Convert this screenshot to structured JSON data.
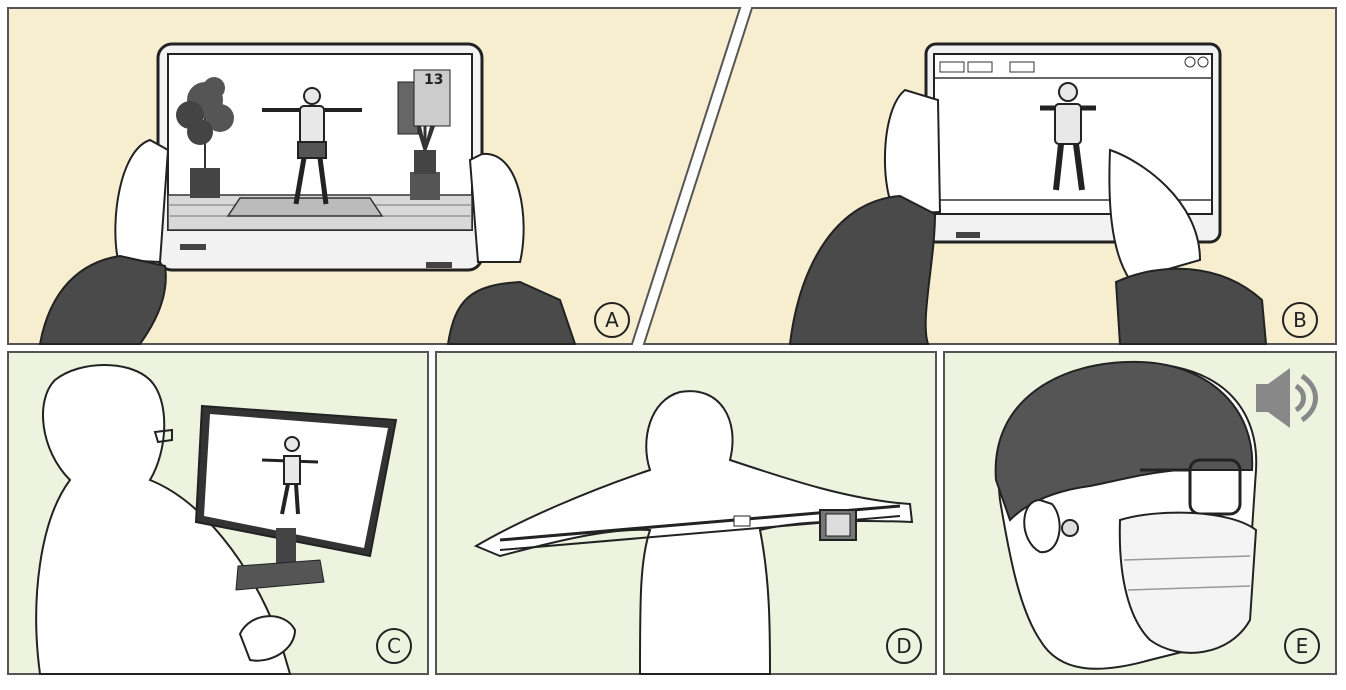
{
  "panels": [
    {
      "id": "A",
      "label": "A",
      "bg": "#f6eecf"
    },
    {
      "id": "B",
      "label": "B",
      "bg": "#f6eecf"
    },
    {
      "id": "C",
      "label": "C",
      "bg": "#eef3df"
    },
    {
      "id": "D",
      "label": "D",
      "bg": "#eef3df"
    },
    {
      "id": "E",
      "label": "E",
      "bg": "#eef3df"
    }
  ],
  "panel_a": {
    "rep_counter": "13"
  },
  "icons": {
    "speaker": "speaker-volume-icon"
  },
  "colors": {
    "ink": "#222222",
    "frame": "#555555",
    "sleeve": "#4a4a4a"
  }
}
